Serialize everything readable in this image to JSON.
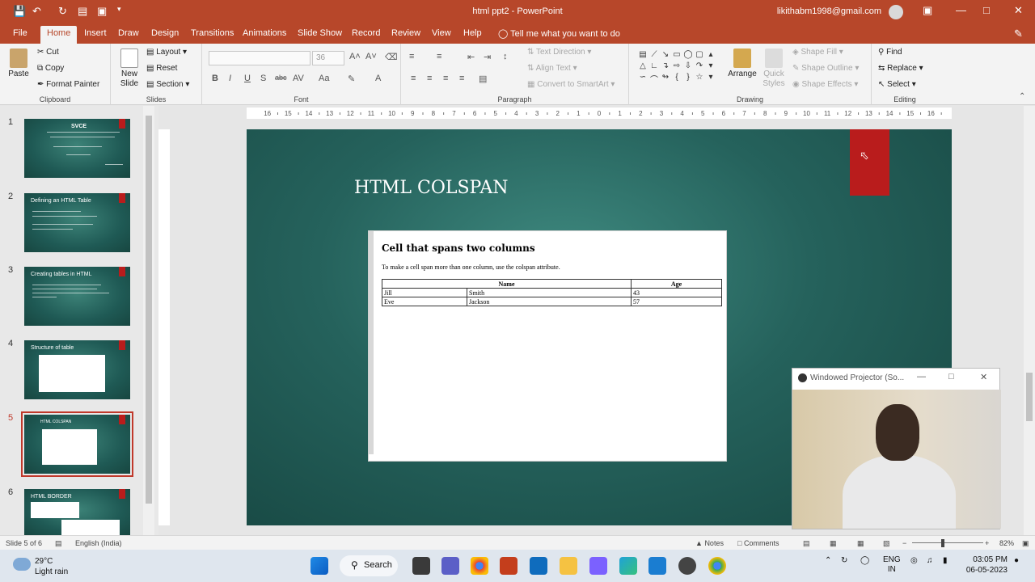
{
  "window": {
    "title": "html ppt2  -  PowerPoint",
    "account": "likithabm1998@gmail.com"
  },
  "ribbon_tabs": [
    "File",
    "Home",
    "Insert",
    "Draw",
    "Design",
    "Transitions",
    "Animations",
    "Slide Show",
    "Record",
    "Review",
    "View",
    "Help"
  ],
  "active_tab": "Home",
  "tell_me": "Tell me what you want to do",
  "clipboard": {
    "paste": "Paste",
    "cut": "Cut",
    "copy": "Copy",
    "format_painter": "Format Painter",
    "label": "Clipboard"
  },
  "slides_group": {
    "new_slide_1": "New",
    "new_slide_2": "Slide",
    "layout": "Layout",
    "reset": "Reset",
    "section": "Section",
    "label": "Slides"
  },
  "font_group": {
    "size": "36",
    "label": "Font"
  },
  "paragraph_group": {
    "text_direction": "Text Direction",
    "align_text": "Align Text",
    "smartart": "Convert to SmartArt",
    "label": "Paragraph"
  },
  "drawing_group": {
    "arrange": "Arrange",
    "quick_styles_1": "Quick",
    "quick_styles_2": "Styles",
    "shape_fill": "Shape Fill",
    "shape_outline": "Shape Outline",
    "shape_effects": "Shape Effects",
    "label": "Drawing"
  },
  "editing_group": {
    "find": "Find",
    "replace": "Replace",
    "select": "Select",
    "label": "Editing"
  },
  "ruler_ticks": [
    "16",
    "15",
    "14",
    "13",
    "12",
    "11",
    "10",
    "9",
    "8",
    "7",
    "6",
    "5",
    "4",
    "3",
    "2",
    "1",
    "0",
    "1",
    "2",
    "3",
    "4",
    "5",
    "6",
    "7",
    "8",
    "9",
    "10",
    "11",
    "12",
    "13",
    "14",
    "15",
    "16"
  ],
  "thumbnails": [
    {
      "num": "1",
      "title": "SVCE"
    },
    {
      "num": "2",
      "title": "Defining an HTML Table"
    },
    {
      "num": "3",
      "title": "Creating tables in HTML"
    },
    {
      "num": "4",
      "title": "Structure of table"
    },
    {
      "num": "5",
      "title": "HTML COLSPAN"
    },
    {
      "num": "6",
      "title": "HTML BORDER"
    }
  ],
  "slide": {
    "title": "HTML COLSPAN",
    "web_heading": "Cell that spans two columns",
    "web_paragraph": "To make a cell span more than one column, use the colspan attribute.",
    "table": {
      "headers": [
        "Name",
        "Age"
      ],
      "rows": [
        [
          "Jill",
          "Smith",
          "43"
        ],
        [
          "Eve",
          "Jackson",
          "57"
        ]
      ]
    }
  },
  "projector": {
    "title": "Windowed Projector (So..."
  },
  "statusbar": {
    "slide_info": "Slide 5 of 6",
    "language": "English (India)",
    "notes": "Notes",
    "comments": "Comments",
    "zoom": "82%"
  },
  "taskbar": {
    "temperature": "29°C",
    "weather": "Light rain",
    "search": "Search",
    "lang_1": "ENG",
    "lang_2": "IN",
    "time": "03:05 PM",
    "date": "06-05-2023"
  },
  "colors": {
    "accent": "#b7472a",
    "slide_bg": "#25625c",
    "tag_red": "#b91c1c"
  }
}
